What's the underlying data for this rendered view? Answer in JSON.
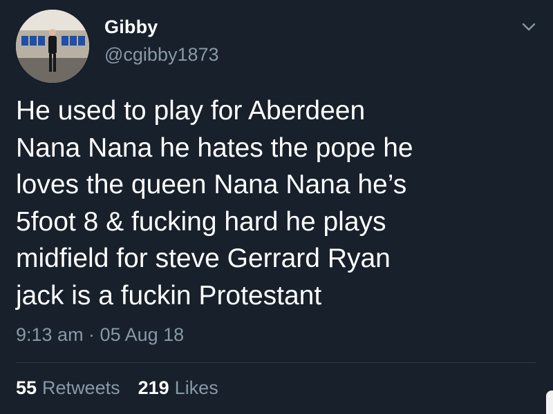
{
  "user": {
    "name": "Gibby",
    "handle": "@cgibby1873",
    "avatar": "profile-photo-man-in-dressing-room"
  },
  "menu_icon": "chevron-down-icon",
  "tweet": {
    "text": "He used to play for Aberdeen\nNana Nana he hates the pope he\nloves the queen Nana Nana he’s\n5foot 8 & fucking hard he plays\nmidfield for steve Gerrard Ryan\njack is a fuckin Protestant",
    "timestamp": "9:13 am · 05 Aug 18"
  },
  "stats": {
    "retweets_count": "55",
    "retweets_label": "Retweets",
    "likes_count": "219",
    "likes_label": "Likes"
  },
  "colors": {
    "background": "#17202b",
    "primary_text": "#ffffff",
    "secondary_text": "#8899a6",
    "divider": "#2f3d4c"
  }
}
